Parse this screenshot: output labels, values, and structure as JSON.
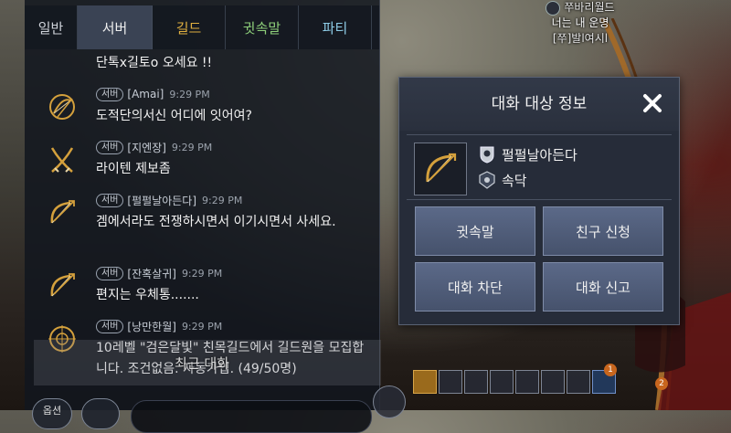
{
  "character_tag": {
    "guild": "쭈바리월드",
    "title": "너는 내 운명",
    "name": "[쭈]발l여시l"
  },
  "chat": {
    "tabs": [
      {
        "label": "일반"
      },
      {
        "label": "서버"
      },
      {
        "label": "길드"
      },
      {
        "label": "귓속말"
      },
      {
        "label": "파티"
      }
    ],
    "top_message": "단톡x길토o 오세요 !!",
    "messages": [
      {
        "badge": "서버",
        "name": "[Amai]",
        "time": "9:29 PM",
        "text": "도적단의서신 어디에 잇어여?",
        "avatar_icon": "bow-wreath-icon"
      },
      {
        "badge": "서버",
        "name": "[지엔장]",
        "time": "9:29 PM",
        "text": "라이텐 제보좀",
        "avatar_icon": "crossed-swords-icon"
      },
      {
        "badge": "서버",
        "name": "[펄펄날아든다]",
        "time": "9:29 PM",
        "text": "겜에서라도 전쟁하시면서 이기시면서 사세요.",
        "avatar_icon": "bow-icon"
      },
      {
        "badge": "서버",
        "name": "[잔혹살귀]",
        "time": "9:29 PM",
        "text": "편지는 우체통.......",
        "avatar_icon": "bow-icon"
      },
      {
        "badge": "서버",
        "name": "[낭만한월]",
        "time": "9:29 PM",
        "text": "10레벨 \"검은달빛\" 친목길드에서 길드원을 모집합니다. 조건없음. 자동가입. (49/50명)",
        "avatar_icon": "target-icon"
      }
    ],
    "recent_label": "최근 대화",
    "bottom": {
      "option_label": "옵션"
    }
  },
  "dialog": {
    "title": "대화 대상 정보",
    "target_name": "펄펄날아든다",
    "guild_name": "속닥",
    "buttons": {
      "whisper": "귓속말",
      "friend_request": "친구 신청",
      "block": "대화 차단",
      "report": "대화 신고"
    }
  },
  "quick_slots": {
    "icons": [
      "chest-icon",
      "gift-icon",
      "gift-icon",
      "shop-icon",
      "swords-icon",
      "pvp-icon",
      "emblem-icon",
      "more-icon"
    ],
    "badges": [
      "1",
      "2"
    ]
  },
  "colors": {
    "guild_tab": "#e0b040",
    "whisper_tab": "#8ed07a",
    "party_tab": "#8ecde8",
    "dialog_button": "#515d7a",
    "icon_gold": "#d4a03c"
  }
}
